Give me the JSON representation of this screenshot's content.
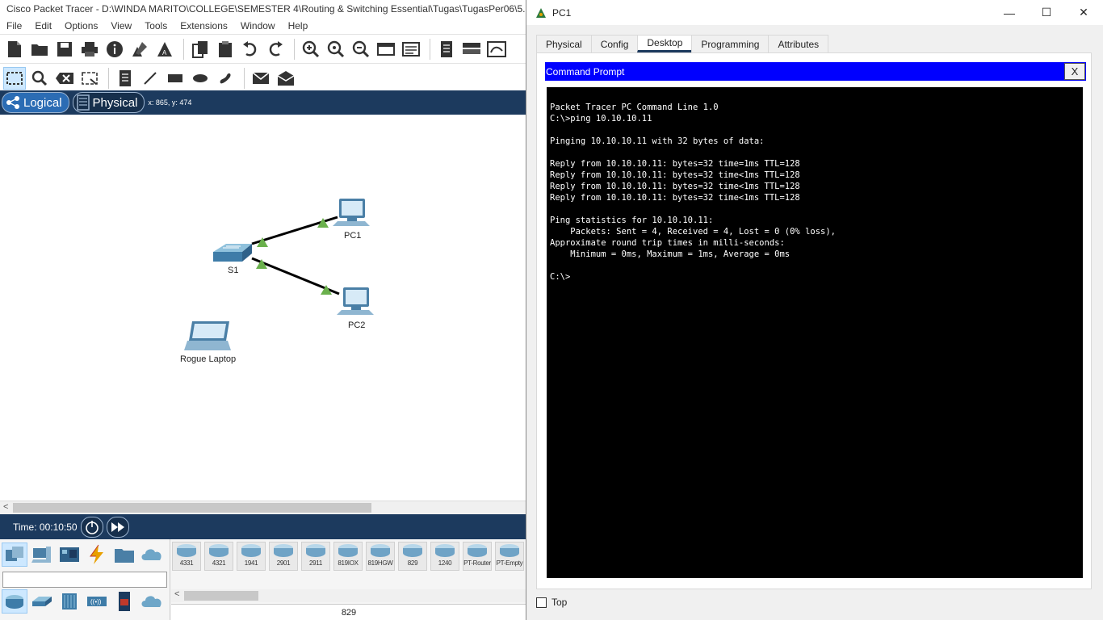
{
  "main_window": {
    "title": "Cisco Packet Tracer - D:\\WINDA MARITO\\COLLEGE\\SEMESTER 4\\Routing & Switching Essential\\Tugas\\TugasPer06\\5.2.2",
    "menu": [
      "File",
      "Edit",
      "Options",
      "View",
      "Tools",
      "Extensions",
      "Window",
      "Help"
    ],
    "toolbar1_icons": [
      "new-file-icon",
      "open-folder-icon",
      "save-icon",
      "print-icon",
      "info-icon",
      "activity-wizard-icon",
      "custom-icon",
      "copy-icon",
      "paste-icon",
      "undo-icon",
      "redo-icon",
      "zoom-in-icon",
      "zoom-reset-icon",
      "zoom-out-icon",
      "drawing-palette-icon",
      "custom-devices-icon",
      "notes-icon",
      "viewport-icon",
      "network-info-icon"
    ],
    "toolbar2_icons": [
      "select-icon",
      "inspect-icon",
      "delete-icon",
      "resize-icon",
      "note-icon",
      "line-draw-icon",
      "rectangle-icon",
      "ellipse-icon",
      "freeform-icon",
      "simple-pdu-icon",
      "complex-pdu-icon"
    ],
    "modes": {
      "logical": "Logical",
      "physical": "Physical"
    },
    "coords": "x: 865, y: 474",
    "topology": {
      "nodes": [
        {
          "id": "pc1",
          "label": "PC1",
          "type": "pc"
        },
        {
          "id": "s1",
          "label": "S1",
          "type": "switch"
        },
        {
          "id": "pc2",
          "label": "PC2",
          "type": "pc"
        },
        {
          "id": "laptop",
          "label": "Rogue Laptop",
          "type": "laptop"
        }
      ],
      "link_color": "#000000",
      "link_status_color": "#6ab04c"
    },
    "time": "Time: 00:10:50",
    "device_categories_row1": [
      "network-devices-icon",
      "end-devices-icon",
      "components-icon",
      "connections-icon",
      "miscellaneous-icon",
      "multiuser-icon"
    ],
    "device_categories_row2": [
      "routers-icon",
      "switches-icon",
      "hubs-icon",
      "wireless-devices-icon",
      "security-icon",
      "wan-emulation-icon"
    ],
    "models": [
      "4331",
      "4321",
      "1941",
      "2901",
      "2911",
      "819IOX",
      "819HGW",
      "829",
      "1240",
      "PT-Router",
      "PT-Empty"
    ],
    "selected_model": "829"
  },
  "pc_window": {
    "title": "PC1",
    "controls": {
      "minimize": "—",
      "maximize": "☐",
      "close": "✕"
    },
    "tabs": [
      "Physical",
      "Config",
      "Desktop",
      "Programming",
      "Attributes"
    ],
    "active_tab": "Desktop",
    "command_prompt_title": "Command Prompt",
    "close_label": "X",
    "terminal_lines": [
      "Packet Tracer PC Command Line 1.0",
      "C:\\>ping 10.10.10.11",
      "",
      "Pinging 10.10.10.11 with 32 bytes of data:",
      "",
      "Reply from 10.10.10.11: bytes=32 time=1ms TTL=128",
      "Reply from 10.10.10.11: bytes=32 time<1ms TTL=128",
      "Reply from 10.10.10.11: bytes=32 time<1ms TTL=128",
      "Reply from 10.10.10.11: bytes=32 time<1ms TTL=128",
      "",
      "Ping statistics for 10.10.10.11:",
      "    Packets: Sent = 4, Received = 4, Lost = 0 (0% loss),",
      "Approximate round trip times in milli-seconds:",
      "    Minimum = 0ms, Maximum = 1ms, Average = 0ms",
      "",
      "C:\\>"
    ],
    "top_label": "Top"
  },
  "colors": {
    "mode_bar": "#1c3a5e",
    "cmd_header": "#0000ff",
    "terminal_bg": "#000000",
    "terminal_fg": "#ffffff"
  }
}
